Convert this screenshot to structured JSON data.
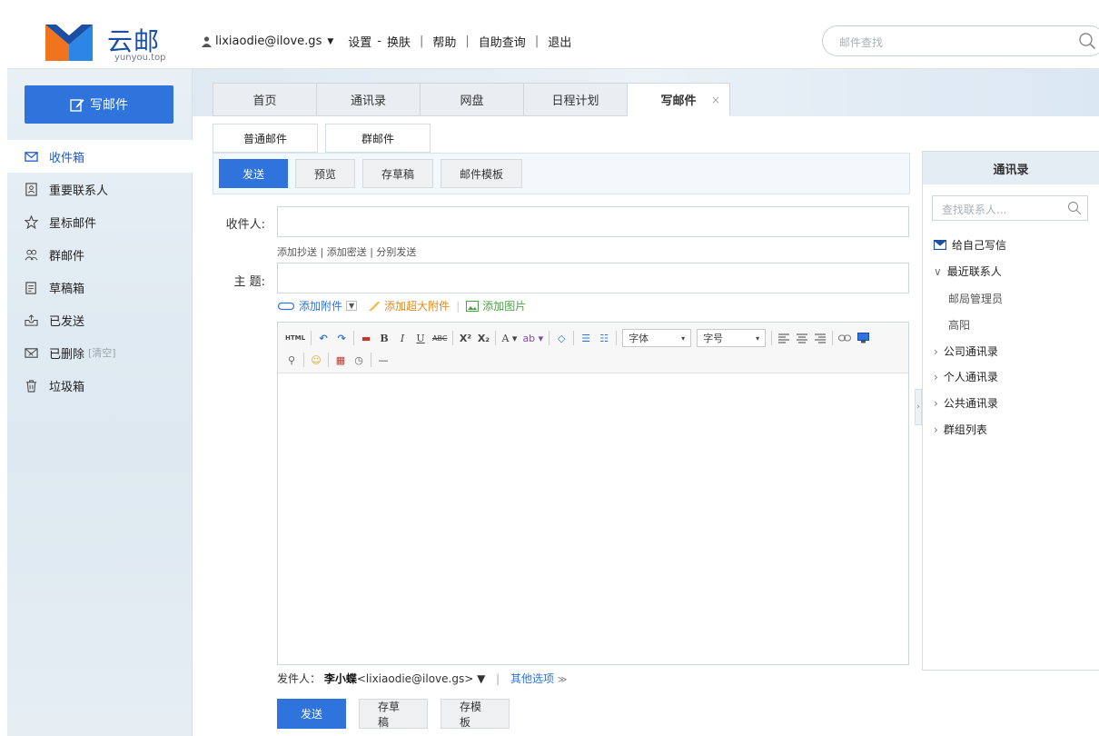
{
  "brand": {
    "name": "云邮",
    "sub": "yunyou.top"
  },
  "sidebar": {
    "compose_label": "写邮件",
    "items": [
      {
        "label": "收件箱",
        "icon": "inbox-icon"
      },
      {
        "label": "重要联系人",
        "icon": "contact-card-icon"
      },
      {
        "label": "星标邮件",
        "icon": "star-icon"
      },
      {
        "label": "群邮件",
        "icon": "group-icon"
      },
      {
        "label": "草稿箱",
        "icon": "draft-icon"
      },
      {
        "label": "已发送",
        "icon": "sent-icon"
      },
      {
        "label": "已删除",
        "extra": "[清空]",
        "icon": "deleted-icon"
      },
      {
        "label": "垃圾箱",
        "icon": "trash-icon"
      }
    ]
  },
  "header": {
    "user": "lixiaodie@ilove.gs",
    "links": [
      "设置",
      "换肤",
      "帮助",
      "自助查询",
      "退出"
    ],
    "search_placeholder": "邮件查找"
  },
  "tabs": [
    {
      "label": "首页"
    },
    {
      "label": "通讯录"
    },
    {
      "label": "网盘"
    },
    {
      "label": "日程计划"
    },
    {
      "label": "写邮件",
      "close": "×"
    }
  ],
  "compose": {
    "subtabs": [
      "普通邮件",
      "群邮件"
    ],
    "toolbar": [
      "发送",
      "预览",
      "存草稿",
      "邮件模板"
    ],
    "to_label": "收件人:",
    "cc_links": [
      "添加抄送",
      "添加密送",
      "分别发送"
    ],
    "subject_label": "主  题:",
    "attach_label": "添加附件",
    "big_attach_label": "添加超大附件",
    "image_label": "添加图片",
    "editor": {
      "row1": [
        "HTML",
        "↶",
        "↷",
        "▬",
        "B",
        "I",
        "U",
        "ABC",
        "X²",
        "X₂",
        "A ▾",
        "ab ▾",
        "◇",
        "☰",
        "☷"
      ],
      "font_label": "字体",
      "size_label": "字号",
      "row2": [
        "⚲",
        "☺",
        "▦",
        "◷",
        "—"
      ]
    },
    "sender_label": "发件人：",
    "sender_name": "李小蝶",
    "sender_email": "<lixiaodie@ilove.gs> ▼",
    "other_options": "其他选项",
    "bottom_buttons": [
      "发送",
      "存草稿",
      "存模板"
    ]
  },
  "contacts": {
    "title": "通讯录",
    "search_placeholder": "查找联系人...",
    "self_write": "给自己写信",
    "recent": "最近联系人",
    "recent_items": [
      "邮局管理员",
      "高阳"
    ],
    "groups": [
      "公司通讯录",
      "个人通讯录",
      "公共通讯录",
      "群组列表"
    ]
  },
  "colors": {
    "accent": "#2f74dc",
    "brand": "#1a4fa3"
  }
}
